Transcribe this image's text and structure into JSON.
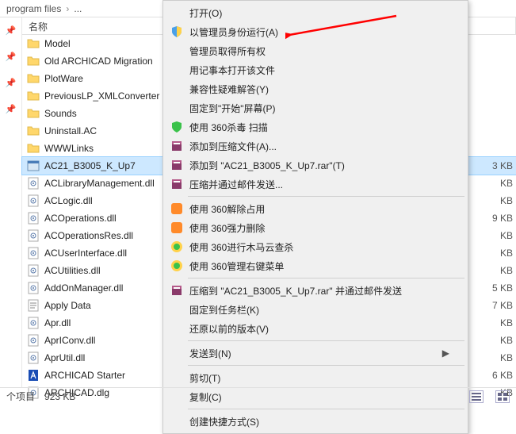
{
  "breadcrumb": {
    "seg1": "program files",
    "seg2": "..."
  },
  "columns": {
    "name": "名称"
  },
  "files": [
    {
      "label": "Model",
      "type": "folder",
      "size": ""
    },
    {
      "label": "Old ARCHICAD Migration",
      "type": "folder",
      "size": ""
    },
    {
      "label": "PlotWare",
      "type": "folder",
      "size": ""
    },
    {
      "label": "PreviousLP_XMLConverter",
      "type": "folder",
      "size": ""
    },
    {
      "label": "Sounds",
      "type": "folder",
      "size": ""
    },
    {
      "label": "Uninstall.AC",
      "type": "folder",
      "size": ""
    },
    {
      "label": "WWWLinks",
      "type": "folder",
      "size": ""
    },
    {
      "label": "AC21_B3005_K_Up7",
      "type": "app",
      "size": "3 KB",
      "selected": true
    },
    {
      "label": "ACLibraryManagement.dll",
      "type": "file",
      "size": "KB"
    },
    {
      "label": "ACLogic.dll",
      "type": "file",
      "size": "KB"
    },
    {
      "label": "ACOperations.dll",
      "type": "file",
      "size": "9 KB"
    },
    {
      "label": "ACOperationsRes.dll",
      "type": "file",
      "size": "KB"
    },
    {
      "label": "ACUserInterface.dll",
      "type": "file",
      "size": "KB"
    },
    {
      "label": "ACUtilities.dll",
      "type": "file",
      "size": "KB"
    },
    {
      "label": "AddOnManager.dll",
      "type": "file",
      "size": "5 KB"
    },
    {
      "label": "Apply Data",
      "type": "txt",
      "size": "7 KB"
    },
    {
      "label": "Apr.dll",
      "type": "file",
      "size": "KB"
    },
    {
      "label": "AprIConv.dll",
      "type": "file",
      "size": "KB"
    },
    {
      "label": "AprUtil.dll",
      "type": "file",
      "size": "KB"
    },
    {
      "label": "ARCHICAD Starter",
      "type": "starter",
      "size": "6 KB"
    },
    {
      "label": "ARCHICAD.dlg",
      "type": "file",
      "size": "KB"
    }
  ],
  "menu": [
    {
      "label": "打开(O)",
      "icon": ""
    },
    {
      "label": "以管理员身份运行(A)",
      "icon": "shield"
    },
    {
      "label": "管理员取得所有权",
      "icon": ""
    },
    {
      "label": "用记事本打开该文件",
      "icon": ""
    },
    {
      "label": "兼容性疑难解答(Y)",
      "icon": ""
    },
    {
      "label": "固定到\"开始\"屏幕(P)",
      "icon": ""
    },
    {
      "label": "使用 360杀毒 扫描",
      "icon": "360green"
    },
    {
      "label": "添加到压缩文件(A)...",
      "icon": "rar"
    },
    {
      "label": "添加到 \"AC21_B3005_K_Up7.rar\"(T)",
      "icon": "rar"
    },
    {
      "label": "压缩并通过邮件发送...",
      "icon": "rar"
    },
    {
      "sep": true
    },
    {
      "label": "使用 360解除占用",
      "icon": "360orange"
    },
    {
      "label": "使用 360强力删除",
      "icon": "360orange"
    },
    {
      "label": "使用 360进行木马云查杀",
      "icon": "360yellow"
    },
    {
      "label": "使用 360管理右键菜单",
      "icon": "360yellow"
    },
    {
      "sep": true
    },
    {
      "label": "压缩到 \"AC21_B3005_K_Up7.rar\" 并通过邮件发送",
      "icon": "rar"
    },
    {
      "label": "固定到任务栏(K)",
      "icon": ""
    },
    {
      "label": "还原以前的版本(V)",
      "icon": ""
    },
    {
      "sep": true
    },
    {
      "label": "发送到(N)",
      "icon": "",
      "sub": true
    },
    {
      "sep": true
    },
    {
      "label": "剪切(T)",
      "icon": ""
    },
    {
      "label": "复制(C)",
      "icon": ""
    },
    {
      "sep": true
    },
    {
      "label": "创建快捷方式(S)",
      "icon": ""
    }
  ],
  "status": {
    "items": "个项目",
    "size": "923 KB"
  }
}
